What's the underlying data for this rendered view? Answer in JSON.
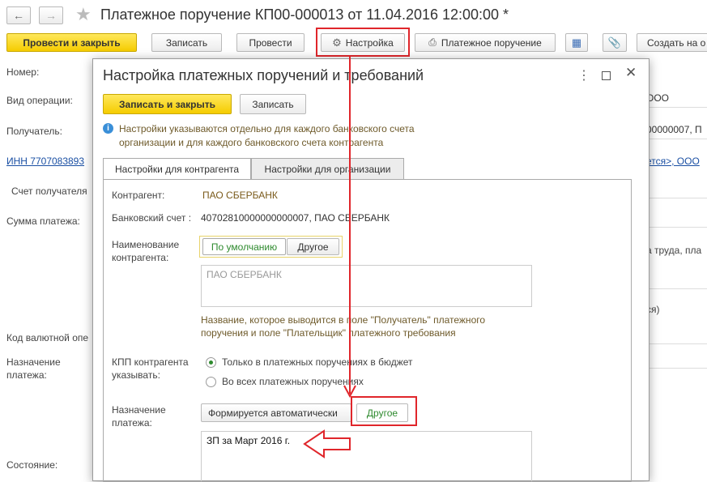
{
  "window": {
    "title": "Платежное поручение КП00-000013 от 11.04.2016 12:00:00 *"
  },
  "toolbar": {
    "post_close": "Провести и закрыть",
    "save": "Записать",
    "post": "Провести",
    "settings": "Настройка",
    "payment_order": "Платежное поручение",
    "create_based": "Создать на о"
  },
  "form": {
    "number_label": "Номер:",
    "operation_label": "Вид операции:",
    "recipient_label": "Получатель:",
    "inn_link": "ИНН 7707083893",
    "account_label": "Счет получателя",
    "amount_label": "Сумма платежа:",
    "currency_label": "Код валютной опе",
    "purpose_label1": "Назначение",
    "purpose_label2": "платежа:",
    "state_label": "Состояние:",
    "right_ooo": "ООО",
    "right_account": "00000007, П",
    "right_link": "ется>, ООО",
    "right_labor": "а труда, пла",
    "right_paren": "ся)"
  },
  "dialog": {
    "title": "Настройка платежных поручений и требований",
    "save_close": "Записать и закрыть",
    "save": "Записать",
    "info_line1": "Настройки указываются отдельно для каждого банковского счета",
    "info_line2": "организации и для каждого банковского счета контрагента",
    "tab_counterparty": "Настройки для контрагента",
    "tab_organization": "Настройки для организации",
    "counterparty_label": "Контрагент:",
    "counterparty_value": "ПАО СБЕРБАНК",
    "bank_account_label": "Банковский счет :",
    "bank_account_value": "40702810000000000007, ПАО СБЕРБАНК",
    "name_label1": "Наименование",
    "name_label2": "контрагента:",
    "name_default": "По умолчанию",
    "name_other": "Другое",
    "name_text": "ПАО СБЕРБАНК",
    "name_hint1": "Название, которое выводится в поле \"Получатель\" платежного",
    "name_hint2": "поручения и поле \"Плательщик\" платежного требования",
    "kpp_label1": "КПП контрагента",
    "kpp_label2": "указывать:",
    "kpp_opt1": "Только в платежных поручениях в бюджет",
    "kpp_opt2": "Во всех платежных поручениях",
    "purpose_label1": "Назначение",
    "purpose_label2": "платежа:",
    "purpose_auto": "Формируется автоматически",
    "purpose_other": "Другое",
    "purpose_text": "ЗП за Март 2016 г."
  },
  "colors": {
    "accent_yellow": "#f5cc00",
    "annotation_red": "#e0262b",
    "active_green": "#2e8a2e"
  }
}
